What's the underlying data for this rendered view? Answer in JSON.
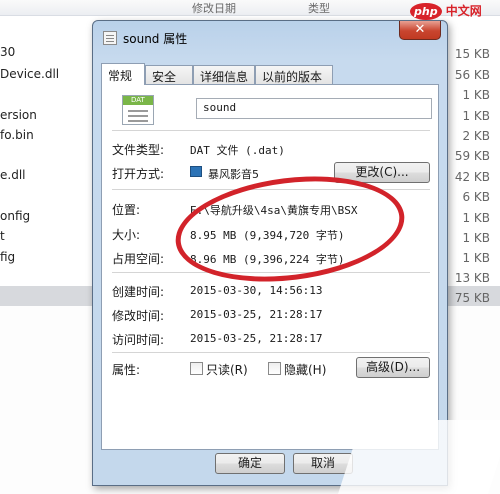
{
  "background": {
    "header": {
      "col_modified": "修改日期",
      "col_type": "类型"
    },
    "left_items": [
      "30",
      "Device.dll",
      "ersion",
      "fo.bin",
      "e.dll",
      "onfig",
      "t",
      "fig"
    ],
    "right_sizes": [
      "15 KB",
      "56 KB",
      "1 KB",
      "1 KB",
      "2 KB",
      "59 KB",
      "42 KB",
      "6 KB",
      "1 KB",
      "1 KB",
      "1 KB",
      "13 KB",
      "75 KB"
    ]
  },
  "dialog": {
    "title": "sound 属性",
    "close_glyph": "✕",
    "tabs": [
      "常规",
      "安全",
      "详细信息",
      "以前的版本"
    ],
    "file_name": "sound",
    "file_icon_text": "DAT",
    "rows": {
      "file_type": {
        "label": "文件类型:",
        "value": "DAT 文件 (.dat)"
      },
      "open_with": {
        "label": "打开方式:",
        "value": "暴风影音5",
        "button": "更改(C)..."
      },
      "location": {
        "label": "位置:",
        "value": "E:\\导航升级\\4sa\\黄旗专用\\BSX"
      },
      "size": {
        "label": "大小:",
        "value": "8.95 MB (9,394,720 字节)"
      },
      "size_on_disk": {
        "label": "占用空间:",
        "value": "8.96 MB (9,396,224 字节)"
      },
      "created": {
        "label": "创建时间:",
        "value": "2015-03-30, 14:56:13"
      },
      "modified": {
        "label": "修改时间:",
        "value": "2015-03-25, 21:28:17"
      },
      "accessed": {
        "label": "访问时间:",
        "value": "2015-03-25, 21:28:17"
      },
      "attributes": {
        "label": "属性:",
        "readonly": "只读(R)",
        "hidden": "隐藏(H)",
        "advanced": "高级(D)..."
      }
    },
    "buttons": {
      "ok": "确定",
      "cancel": "取消"
    }
  },
  "watermark": {
    "logo_mark": "php",
    "logo_text": "中文网"
  },
  "colors": {
    "highlight_ellipse": "#d2232a"
  }
}
